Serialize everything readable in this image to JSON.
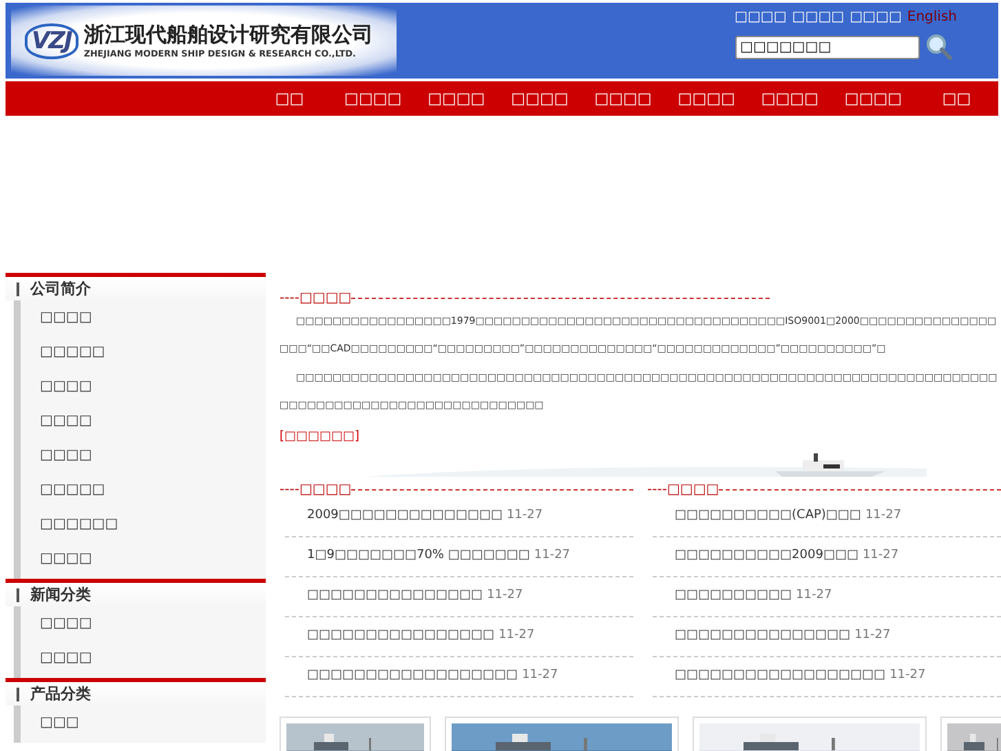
{
  "header": {
    "logo_mark": "VZJ",
    "company_name": "浙江现代船舶设计研究有限公司",
    "company_name_en": "ZHEJIANG MODERN SHIP DESIGN & RESEARCH CO.,LTD.",
    "top_links": [
      {
        "label": "□□□□",
        "kind": "plain"
      },
      {
        "label": "□□□□",
        "kind": "plain"
      },
      {
        "label": "□□□□",
        "kind": "plain"
      },
      {
        "label": "English",
        "kind": "accent"
      }
    ],
    "search": {
      "value": "□□□□□□□"
    }
  },
  "nav": [
    "□□",
    "□□□□",
    "□□□□",
    "□□□□",
    "□□□□",
    "□□□□",
    "□□□□",
    "□□□□",
    "□□"
  ],
  "sidebar": [
    {
      "title": "公司简介",
      "items": [
        "□□□□",
        "□□□□□",
        "□□□□",
        "□□□□",
        "□□□□",
        "□□□□□",
        "□□□□□□",
        "□□□□"
      ]
    },
    {
      "title": "新闻分类",
      "items": [
        "□□□□",
        "□□□□"
      ]
    },
    {
      "title": "产品分类",
      "items": [
        "□□□"
      ]
    }
  ],
  "intro": {
    "heading_prefix": "----",
    "heading": "□□□□",
    "paragraphs": [
      "□□□□□□□□□□□□□□□□□1979□□□□□□□□□□□□□□□□□□□□□□□□□□□□□□□□□□ISO9001□2000□□□□□□□□□□□□□□□□□□“□□CAD□□□□□□□□□“□□□□□□□□□”□□□□□□□□□□□□□□“□□□□□□□□□□□□□”□□□□□□□□□□”□",
      "□□□□□□□□□□□□□□□□□□□□□□□□□□□□□□□□□□□□□□□□□□□□□□□□□□□□□□□□□□□□□□□□□□□□□□□□□□□□□□□□□□□□□□□□□□□□□□□□□□□□□□□□□□"
    ],
    "more_link": "[□□□□□□]"
  },
  "news_columns": [
    {
      "heading_prefix": "----",
      "heading": "□□□□",
      "items": [
        {
          "title": "2009□□□□□□□□□□□□□□",
          "date": "11-27"
        },
        {
          "title": "1□9□□□□□□□70% □□□□□□□",
          "date": "11-27"
        },
        {
          "title": "□□□□□□□□□□□□□□□",
          "date": "11-27"
        },
        {
          "title": "□□□□□□□□□□□□□□□□",
          "date": "11-27"
        },
        {
          "title": "□□□□□□□□□□□□□□□□□□",
          "date": "11-27"
        }
      ]
    },
    {
      "heading_prefix": "----",
      "heading": "□□□□",
      "items": [
        {
          "title": "□□□□□□□□□□(CAP)□□□",
          "date": "11-27"
        },
        {
          "title": "□□□□□□□□□□2009□□□",
          "date": "11-27"
        },
        {
          "title": "□□□□□□□□□□",
          "date": "11-27"
        },
        {
          "title": "□□□□□□□□□□□□□□□",
          "date": "11-27"
        },
        {
          "title": "□□□□□□□□□□□□□□□□□□",
          "date": "11-27"
        }
      ]
    }
  ]
}
